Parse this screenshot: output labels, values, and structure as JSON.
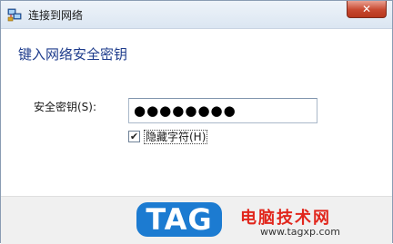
{
  "window": {
    "title": "连接到网络",
    "close_glyph": "✕"
  },
  "dialog": {
    "heading": "键入网络安全密钥",
    "key_label": "安全密钥(S):",
    "key_value": "●●●●●●●●",
    "hide_chars_label": "隐藏字符(H)",
    "hide_chars_checked": true,
    "check_glyph": "✔"
  },
  "watermark": {
    "badge": "TAG",
    "site_name": "电脑技术网",
    "url": "www.tagxp.com"
  },
  "colors": {
    "heading": "#1e3c8c",
    "close_button": "#c7482f",
    "badge": "#1c7bd1",
    "site_name": "#e1261c"
  },
  "icons": [
    "network-icon",
    "close-icon",
    "checkmark-icon"
  ]
}
